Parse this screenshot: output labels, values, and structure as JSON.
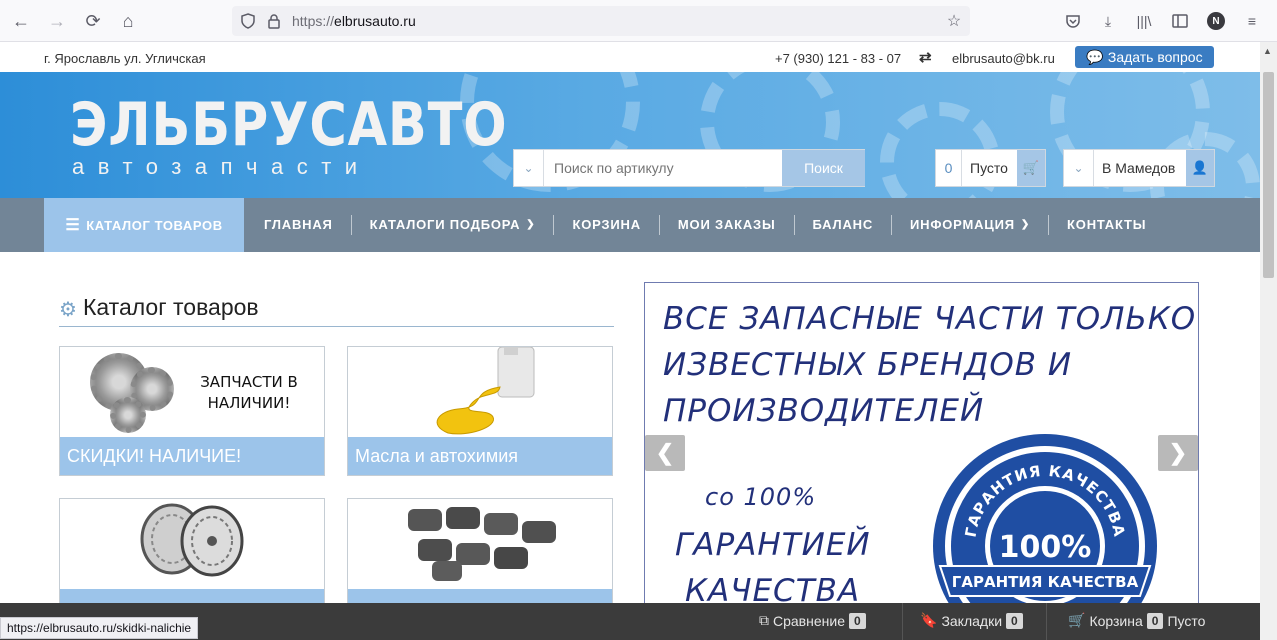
{
  "browser": {
    "url_scheme": "https://",
    "url_host": "elbrusauto.ru",
    "avatar_letter": "N"
  },
  "topbar": {
    "city": "г. Ярославль ул. Угличская",
    "phone": "+7 (930) 121 - 83 - 07",
    "email": "elbrusauto@bk.ru",
    "ask_button": "Задать вопрос"
  },
  "header": {
    "logo_main": "ЭЛЬБРУСАВТО",
    "logo_sub": "автозапчасти",
    "search_placeholder": "Поиск по артикулу",
    "search_button": "Поиск",
    "cart_count": "0",
    "cart_label": "Пусто",
    "user_label": "В Мамедов"
  },
  "nav": {
    "catalog": "КАТАЛОГ ТОВАРОВ",
    "items": [
      {
        "label": "ГЛАВНАЯ"
      },
      {
        "label": "КАТАЛОГИ ПОДБОРА"
      },
      {
        "label": "КОРЗИНА"
      },
      {
        "label": "МОИ ЗАКАЗЫ"
      },
      {
        "label": "БАЛАНС"
      },
      {
        "label": "ИНФОРМАЦИЯ"
      },
      {
        "label": "КОНТАКТЫ"
      }
    ]
  },
  "catalog": {
    "title": "Каталог товаров",
    "cards": [
      {
        "label": "СКИДКИ! НАЛИЧИЕ!",
        "image_text": "ЗАПЧАСТИ В НАЛИЧИИ!"
      },
      {
        "label": "Масла и автохимия"
      },
      {
        "label": ""
      },
      {
        "label": ""
      }
    ]
  },
  "banner": {
    "line1": "ВСЕ ЗАПАСНЫЕ ЧАСТИ ТОЛЬКО",
    "line2": "ИЗВЕСТНЫХ БРЕНДОВ И",
    "line3": "ПРОИЗВОДИТЕЛЕЙ",
    "line4": "со 100%",
    "line5": "ГАРАНТИЕЙ",
    "line6": "КАЧЕСТВА",
    "seal_top": "ГАРАНТИЯ КАЧЕСТВА",
    "seal_percent": "100%",
    "seal_ribbon": "ГАРАНТИЯ КАЧЕСТВА"
  },
  "bottombar": {
    "compare_label": "Сравнение",
    "compare_count": "0",
    "bookmarks_label": "Закладки",
    "bookmarks_count": "0",
    "cart_label": "Корзина",
    "cart_count": "0",
    "cart_status": "Пусто"
  },
  "status_url": "https://elbrusauto.ru/skidki-nalichie"
}
